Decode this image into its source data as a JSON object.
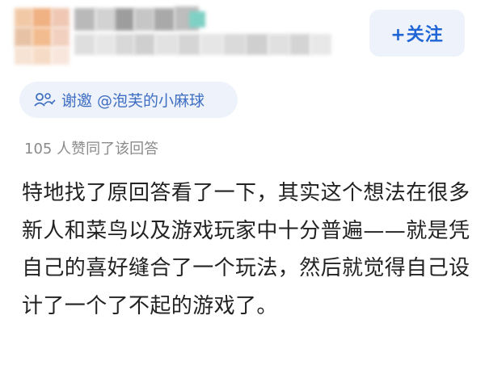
{
  "header": {
    "follow_label": "+关注"
  },
  "invite": {
    "icon": "invite-icon",
    "label": "谢邀 @泡芙的小麻球"
  },
  "stats": {
    "likes_text": "105 人赞同了该回答"
  },
  "answer": {
    "text": "特地找了原回答看了一下，其实这个想法在很多新人和菜鸟以及游戏玩家中十分普遍——就是凭自己的喜好缝合了一个玩法，然后就觉得自己设计了一个了不起的游戏了。"
  },
  "colors": {
    "accent": "#1f65d6",
    "chip_bg": "#eef2fb",
    "muted": "#8a8a8a"
  }
}
